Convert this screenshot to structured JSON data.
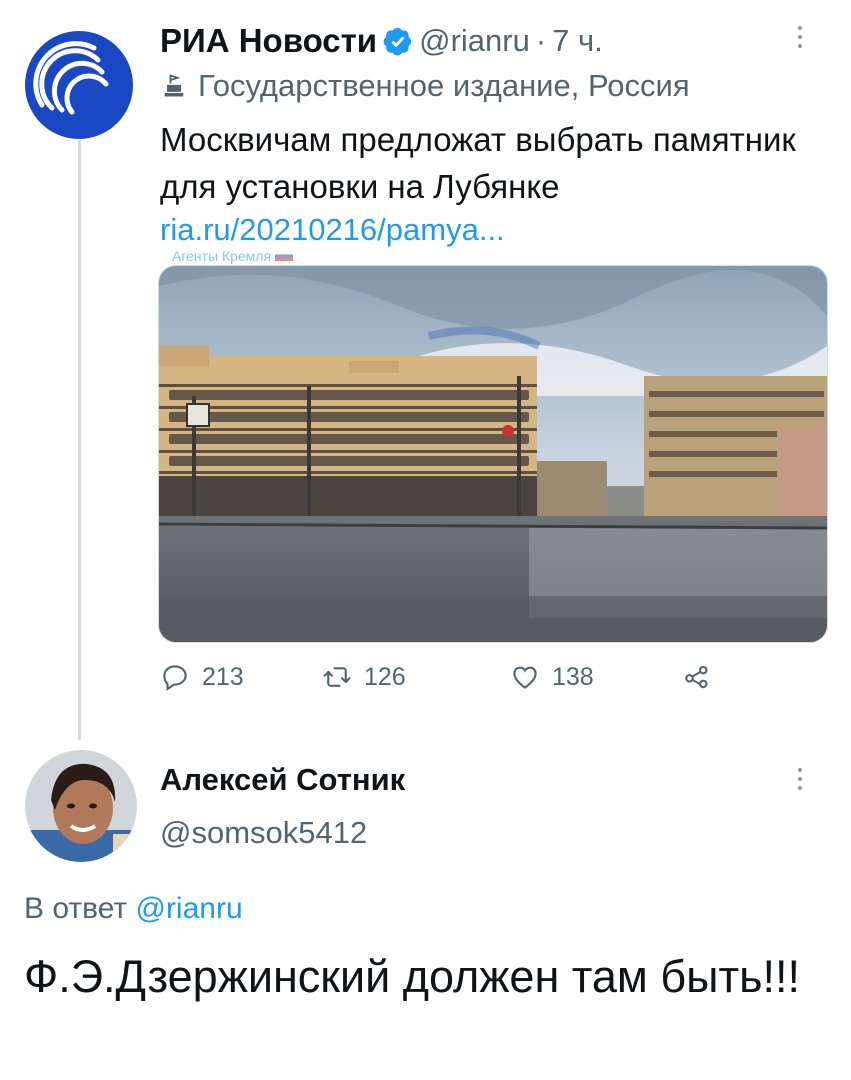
{
  "tweet1": {
    "author_name": "РИА Новости",
    "handle": "@rianru",
    "dot": "·",
    "time": "7 ч.",
    "label": "Государственное издание, Россия",
    "text": "Москвичам предложат выбрать памятник для установки на Лубянке",
    "link": "ria.ru/20210216/pamya...",
    "watermark": "Агенты Кремля",
    "replies": "213",
    "retweets": "126",
    "likes": "138"
  },
  "tweet2": {
    "author_name": "Алексей Сотник",
    "handle": "@somsok5412",
    "reply_prefix": "В ответ",
    "reply_mention": "@rianru",
    "text": "Ф.Э.Дзержинский должен там быть!!!"
  },
  "colors": {
    "accent": "#1d9bf0",
    "secondary_text": "#536471",
    "ria_blue": "#1a48c4"
  },
  "icons": [
    "verified-badge-icon",
    "government-label-icon",
    "more-options-icon",
    "reply-icon",
    "retweet-icon",
    "like-icon",
    "share-icon"
  ]
}
